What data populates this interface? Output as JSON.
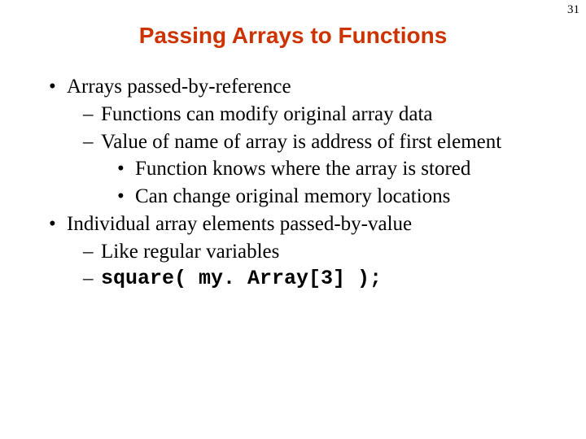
{
  "pageNumber": "31",
  "title": "Passing Arrays to Functions",
  "bullets": {
    "b1": "Arrays passed-by-reference",
    "b1a": "Functions can modify original array data",
    "b1b": "Value of name of array is address of first element",
    "b1b_i": "Function knows where the array is stored",
    "b1b_ii": "Can change original memory locations",
    "b2": "Individual array elements passed-by-value",
    "b2a": "Like regular variables",
    "b2b_code": "square( my. Array[3] );"
  },
  "markers": {
    "dot": "•",
    "dash": "–"
  }
}
